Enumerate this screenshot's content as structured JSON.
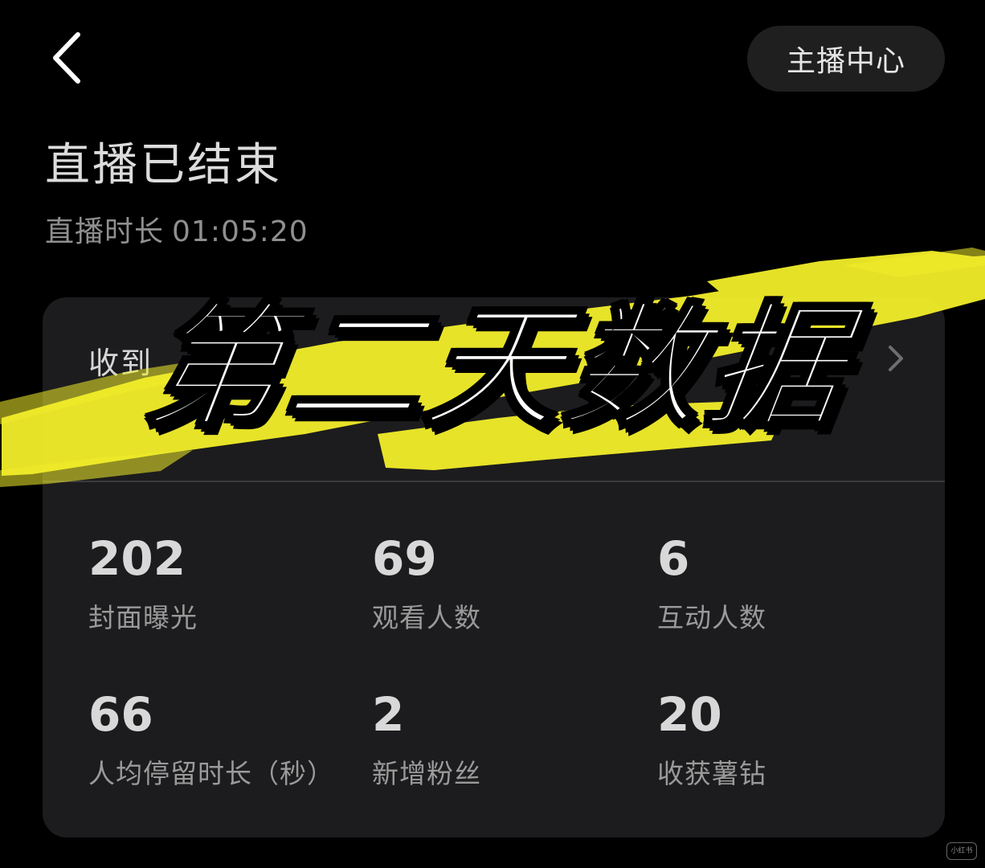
{
  "header": {
    "back_icon": "chevron-left-icon",
    "anchor_center_label": "主播中心"
  },
  "live": {
    "status_title": "直播已结束",
    "duration_label": "直播时长",
    "duration_value": "01:05:20"
  },
  "stats_card": {
    "gift_label": "收到",
    "gift_chevron_icon": "chevron-right-icon",
    "metrics": [
      {
        "value": "202",
        "label": "封面曝光"
      },
      {
        "value": "69",
        "label": "观看人数"
      },
      {
        "value": "6",
        "label": "互动人数"
      },
      {
        "value": "66",
        "label": "人均停留时长（秒）"
      },
      {
        "value": "2",
        "label": "新增粉丝"
      },
      {
        "value": "20",
        "label": "收获薯钻"
      }
    ]
  },
  "overlay": {
    "title": "第二天数据",
    "highlight_color": "#f2ee2a"
  },
  "watermark": {
    "text": "小红书"
  },
  "colors": {
    "background": "#000000",
    "card": "#1c1c1e",
    "button": "#1f1f1f"
  }
}
